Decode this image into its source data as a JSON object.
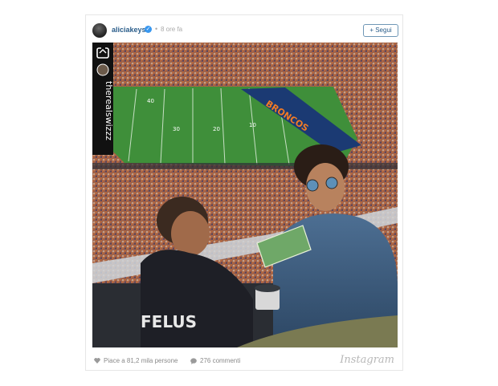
{
  "post": {
    "username": "aliciakeys",
    "time_dot": "•",
    "time": "8 ore fa",
    "follow_label": "+ Segui",
    "repost_credit": "therealswizzz",
    "jersey_text": "FELUS",
    "banner_text": "BRONCOS",
    "yard_labels": [
      "40",
      "30",
      "20",
      "10"
    ],
    "likes": "Piace a 81,2 mila persone",
    "comments": "276 commenti",
    "brand": "Instagram"
  },
  "icons": [
    "verified-icon",
    "repost-icon",
    "heart-icon",
    "comment-icon"
  ],
  "colors": {
    "link": "#2a5d8a",
    "verified": "#3897f0",
    "field": "#3f8f3a",
    "banner": "#1b3a73"
  }
}
